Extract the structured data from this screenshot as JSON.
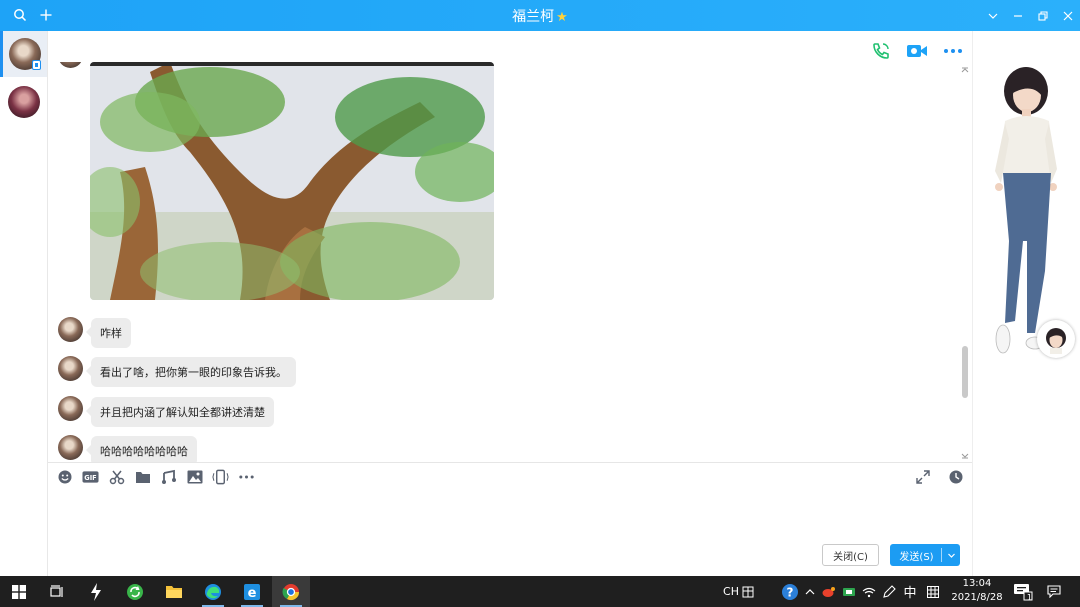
{
  "window": {
    "title": "福兰柯",
    "title_star": "★"
  },
  "messages": [
    {
      "text": "咋样"
    },
    {
      "text": "看出了啥，把你第一眼的印象告诉我。"
    },
    {
      "text": "并且把内涵了解认知全都讲述清楚"
    },
    {
      "text": "哈哈哈哈哈哈哈哈"
    }
  ],
  "composer": {
    "value": "",
    "placeholder": ""
  },
  "buttons": {
    "close_label": "关闭(C)",
    "send_label": "发送(S)"
  },
  "taskbar": {
    "lang_code": "CH",
    "ime_mode": "中",
    "time": "13:04",
    "date": "2021/8/28",
    "notification_count": "1"
  },
  "colors": {
    "titlebar": "#1ea3f7",
    "accent": "#1c9cf3",
    "phone_icon": "#20c070",
    "video_icon": "#1ea3f7",
    "taskbar": "#1f1f1f"
  },
  "icons": {
    "titlebar": [
      "search-icon",
      "plus-icon",
      "chevron-down-icon",
      "minimize-icon",
      "restore-icon",
      "close-icon"
    ],
    "chat_actions": [
      "phone-icon",
      "video-icon",
      "more-icon"
    ],
    "toolbar": [
      "emoji-icon",
      "gif-icon",
      "scissors-icon",
      "folder-icon",
      "music-icon",
      "image-icon",
      "shake-icon",
      "more-icon"
    ],
    "toolbar_right": [
      "expand-icon",
      "history-icon"
    ]
  }
}
